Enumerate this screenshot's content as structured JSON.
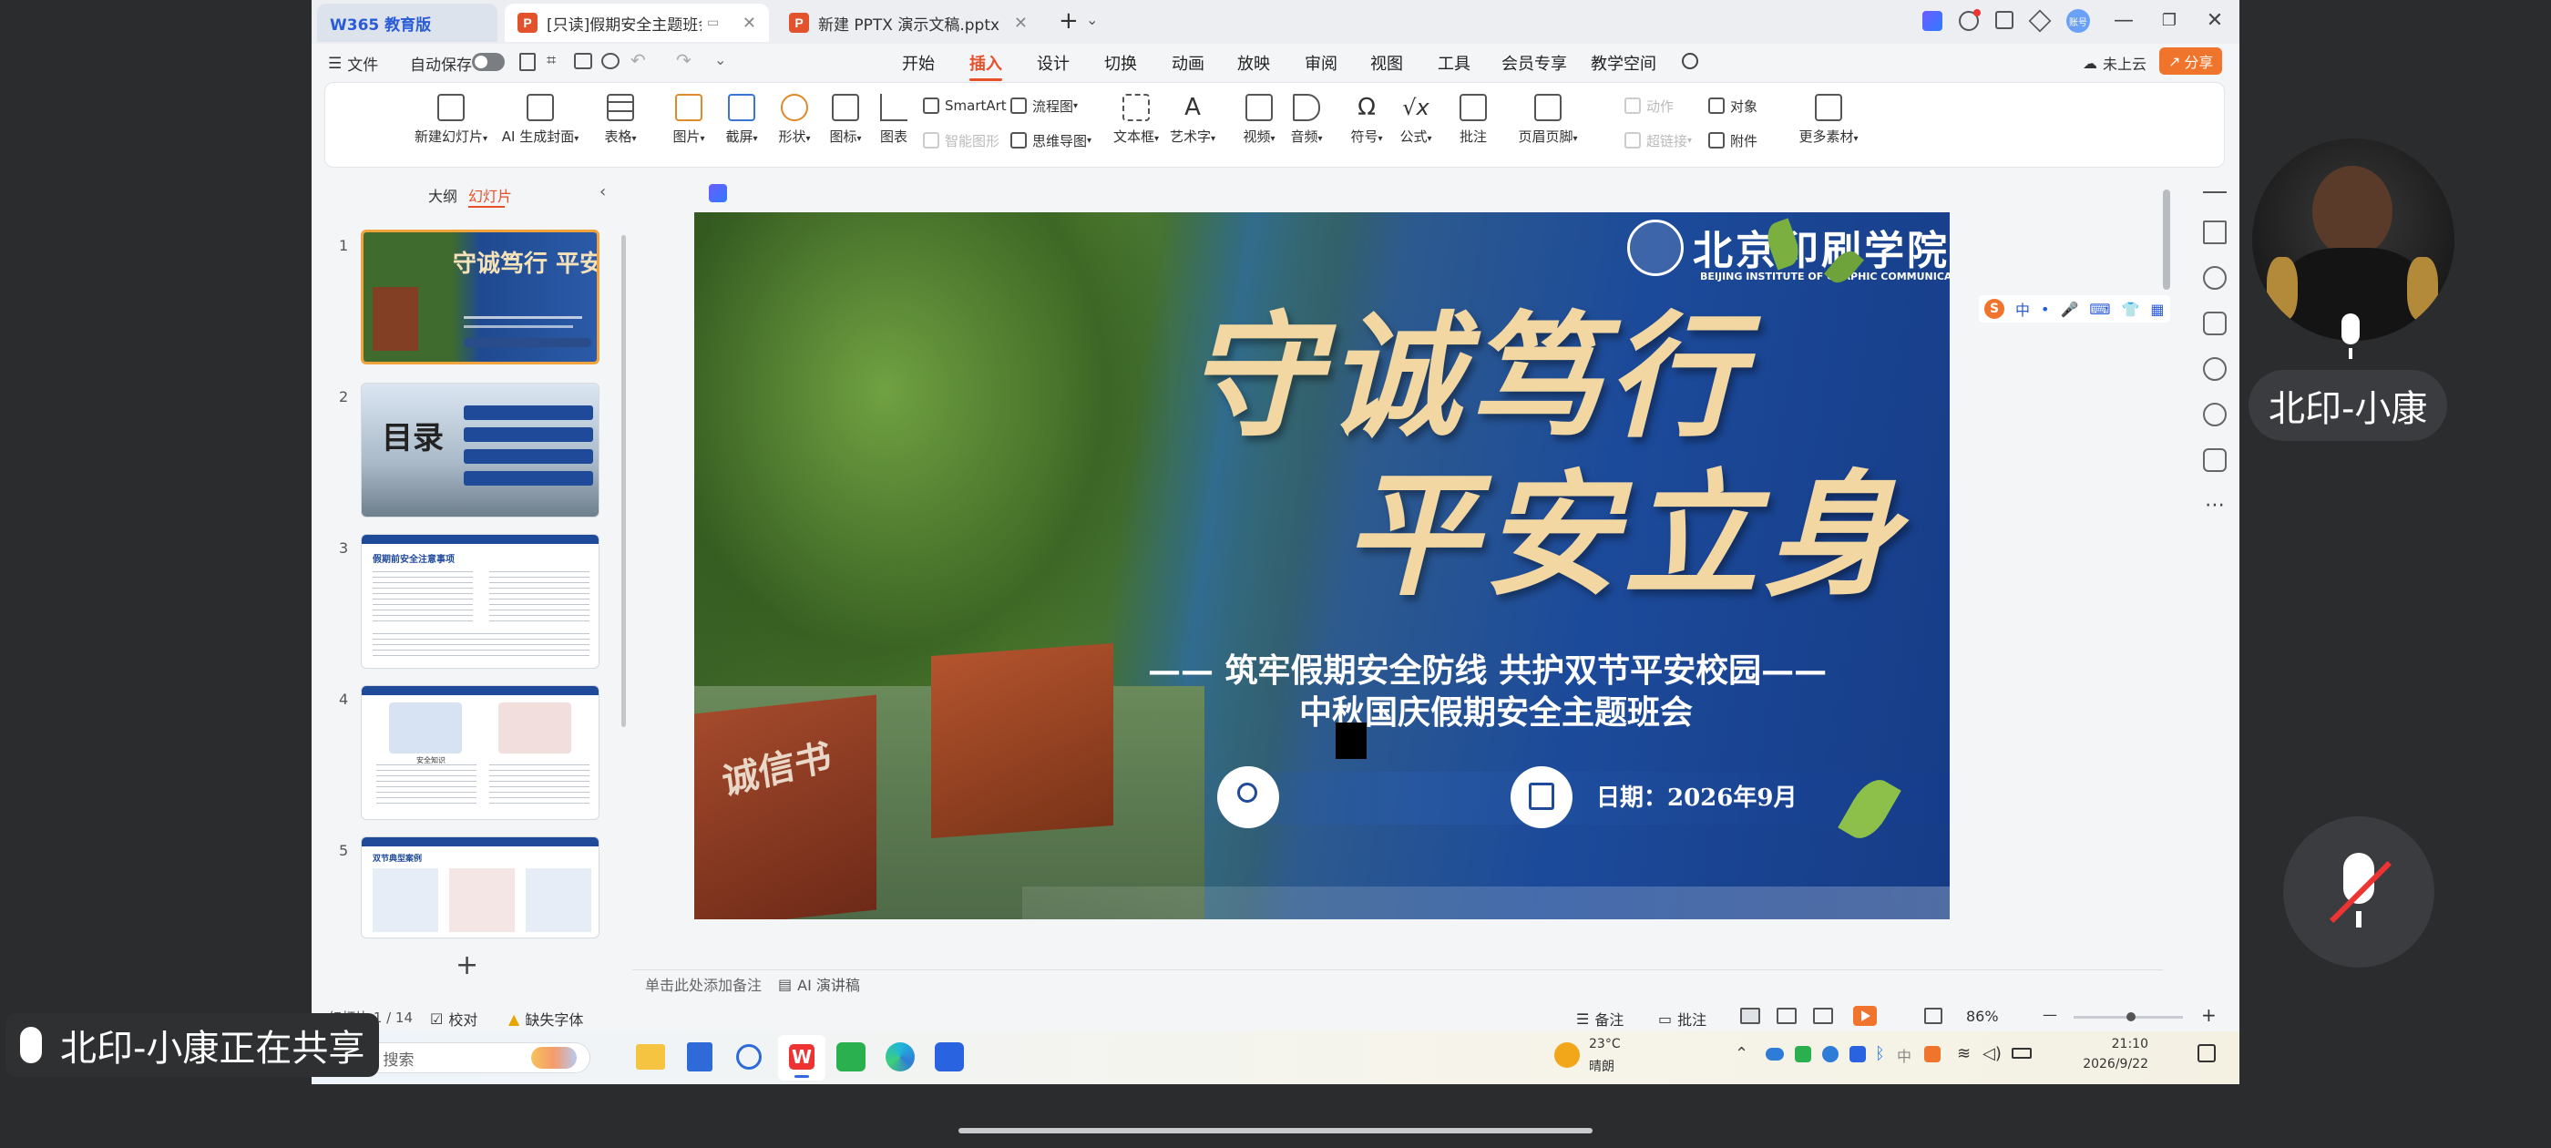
{
  "titlebar": {
    "app_tab": "W365 教育版",
    "doc_tab_1": "[只读]假期安全主题班会.pp",
    "doc_tab_2": "新建 PPTX 演示文稿.pptx",
    "add_tab": "+",
    "avatar_text": "账号"
  },
  "menubar": {
    "file": "文件",
    "autosave": "自动保存",
    "tabs": [
      "开始",
      "插入",
      "设计",
      "切换",
      "动画",
      "放映",
      "审阅",
      "视图",
      "工具",
      "会员专享",
      "教学空间"
    ],
    "active_tab": "插入",
    "cloud": "未上云",
    "share": "分享"
  },
  "ribbon": {
    "new_slide": "新建幻灯片",
    "ai_cover": "AI 生成封面",
    "table": "表格",
    "picture": "图片",
    "screenshot": "截屏",
    "shape": "形状",
    "icon": "图标",
    "chart": "图表",
    "smartart": "SmartArt",
    "flowchart": "流程图",
    "smart_graphic": "智能图形",
    "mindmap": "思维导图",
    "textbox": "文本框",
    "wordart": "艺术字",
    "video": "视频",
    "audio": "音频",
    "symbol": "符号",
    "formula": "公式",
    "comment": "批注",
    "header_footer": "页眉页脚",
    "action": "动作",
    "hyperlink": "超链接",
    "object": "对象",
    "attachment": "附件",
    "more_material": "更多素材"
  },
  "leftpane": {
    "outline_tab": "大纲",
    "slides_tab": "幻灯片",
    "slides": [
      {
        "num": "1",
        "title": "守诚笃行 平安立身"
      },
      {
        "num": "2",
        "title": "目录"
      },
      {
        "num": "3",
        "title": "假期前安全注意事项"
      },
      {
        "num": "4",
        "title": "安全知识"
      },
      {
        "num": "5",
        "title": "双节典型案例"
      }
    ],
    "add": "+"
  },
  "slide": {
    "logo_cn": "北京印刷学院",
    "logo_en": "BEIJING INSTITUTE OF GRAPHIC COMMUNICATION",
    "title_line1": "守诚笃行",
    "title_line2": "平安立身",
    "subtitle1": "——  筑牢假期安全防线 共护双节平安校园——",
    "subtitle2": "中秋国庆假期安全主题班会",
    "date_label": "日期：2026年9月",
    "sign_text": "诚信书"
  },
  "canvas": {
    "notes_placeholder": "单击此处添加备注",
    "ai_script": "AI 演讲稿"
  },
  "ime": {
    "items": [
      "中",
      "•",
      "🎤",
      "⌨",
      "👕",
      "▦"
    ]
  },
  "statusbar": {
    "slide_count": "幻灯片 1 / 14",
    "proofread": "校对",
    "missing_font": "缺失字体",
    "notes": "备注",
    "comments": "批注",
    "zoom": "86%",
    "minus": "—",
    "plus": "+"
  },
  "taskbar": {
    "search_placeholder": "搜索",
    "weather_temp": "23°C",
    "weather_text": "晴朗",
    "time": "21:10",
    "date": "2026/9/22"
  },
  "meeting": {
    "presenter_name": "北印-小康",
    "sharing_status": "北印-小康正在共享"
  },
  "colors": {
    "accent": "#e8502a",
    "slide_blue": "#1f3f7a",
    "title_gold": "#f2d7a2",
    "selection": "#f0a33a"
  }
}
